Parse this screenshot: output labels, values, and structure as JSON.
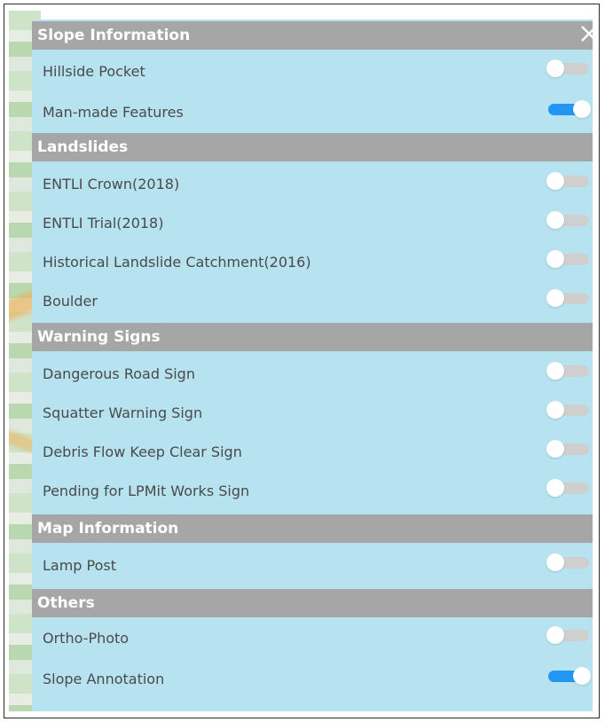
{
  "panel": {
    "sections": [
      {
        "header": "Slope Information",
        "items": [
          {
            "label": "Hillside Pocket",
            "on": false
          },
          {
            "label": "Man-made Features",
            "on": true
          }
        ]
      },
      {
        "header": "Landslides",
        "items": [
          {
            "label": "ENTLI Crown(2018)",
            "on": false
          },
          {
            "label": "ENTLI Trial(2018)",
            "on": false
          },
          {
            "label": "Historical Landslide Catchment(2016)",
            "on": false
          },
          {
            "label": "Boulder",
            "on": false
          }
        ]
      },
      {
        "header": "Warning Signs",
        "items": [
          {
            "label": "Dangerous Road Sign",
            "on": false
          },
          {
            "label": "Squatter Warning Sign",
            "on": false
          },
          {
            "label": "Debris Flow Keep Clear Sign",
            "on": false
          },
          {
            "label": "Pending for LPMit Works Sign",
            "on": false
          }
        ]
      },
      {
        "header": "Map Information",
        "items": [
          {
            "label": "Lamp Post",
            "on": false
          }
        ]
      },
      {
        "header": "Others",
        "items": [
          {
            "label": "Ortho-Photo",
            "on": false
          },
          {
            "label": "Slope Annotation",
            "on": true
          }
        ]
      }
    ]
  },
  "colors": {
    "panel_bg": "#b6e3ef",
    "header_bg": "#a6a6a6",
    "toggle_on": "#2196f3",
    "toggle_off": "#cfcfcf"
  },
  "icons": {
    "close": "close-icon"
  }
}
